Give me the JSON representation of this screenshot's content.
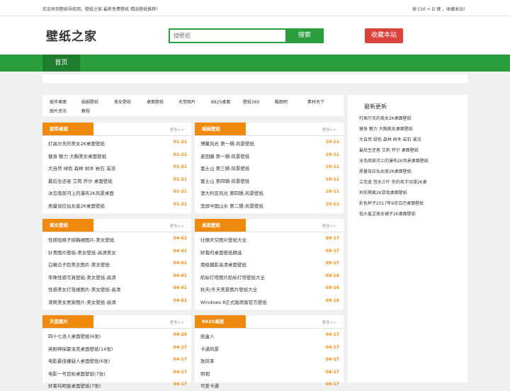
{
  "topbar": {
    "welcome": "欢迎来到壁纸导航网，壁纸之家-最新免费壁纸 精品壁纸推荐！",
    "shortcut": "按 Ctrl + D 键 ，收藏本站！"
  },
  "header": {
    "logo": "壁纸之家",
    "search_placeholder": "搜壁纸",
    "search_label": "搜索",
    "fav_label": "收藏本站"
  },
  "nav": {
    "home": "首页"
  },
  "tags": [
    "彼岸桌面",
    "娟娟壁纸",
    "美女壁纸",
    "桌面壁纸",
    "天堂图片",
    "8825桌面",
    "壁纸360",
    "酷图吧",
    "素材天下",
    "图片资讯",
    "教程"
  ],
  "more_label": "更多>>",
  "cards": [
    {
      "title": "彼岸桌面",
      "rows": [
        {
          "t": "打高尔夫的美女2K桌面壁纸",
          "d": "01-21"
        },
        {
          "t": "健身 魅力 大胸美女桌面壁纸",
          "d": "01-21"
        },
        {
          "t": "大自然 绿色 森林 树木 岩石 溪流",
          "d": "01-21"
        },
        {
          "t": "最后生还者 艾莉 乔尔 桌面壁纸",
          "d": "01-21"
        },
        {
          "t": "冰岛南部河上的瀑布2K风景桌面",
          "d": "01-21"
        },
        {
          "t": "质量效应仙女座2K桌面壁纸",
          "d": "01-21"
        }
      ]
    },
    {
      "title": "娟娟壁纸",
      "rows": [
        {
          "t": "博鳌风光 第一辑-风景壁纸",
          "d": "10-11"
        },
        {
          "t": "麦田圈 第一辑-风景壁纸",
          "d": "10-11"
        },
        {
          "t": "富士山 第三辑-风景壁纸",
          "d": "10-11"
        },
        {
          "t": "富士山 第四辑-风景壁纸",
          "d": "10-11"
        },
        {
          "t": "澳大利亚风光 第四辑-风景壁纸",
          "d": "10-11"
        },
        {
          "t": "宽屏中国山水 第二辑-风景壁纸",
          "d": "10-11"
        }
      ]
    },
    {
      "title": "美女壁纸",
      "rows": [
        {
          "t": "性感短格子抹胸裙图片-美女壁纸",
          "d": "04-01"
        },
        {
          "t": "针青图片壁纸-美女壁纸-高清美女",
          "d": "04-01"
        },
        {
          "t": "白嫩瓜子脸美女图片-美女壁纸",
          "d": "04-01"
        },
        {
          "t": "朱珠性感写真壁纸-美女壁纸-高清",
          "d": "04-01"
        },
        {
          "t": "性感美女灯笼裙图片-美女壁纸-高清",
          "d": "04-01"
        },
        {
          "t": "清爽美女居家图片-美女壁纸-高清",
          "d": "04-01"
        }
      ]
    },
    {
      "title": "桌面壁纸",
      "rows": [
        {
          "t": "壮丽天空图片壁纸大全",
          "d": "09-17"
        },
        {
          "t": "好看的桌面壁纸精选",
          "d": "09-17"
        },
        {
          "t": "南极摄影高清桌面壁纸",
          "d": "09-17"
        },
        {
          "t": "航标灯塔图片航标灯塔壁纸大全",
          "d": "09-16"
        },
        {
          "t": "秋天/冬天美景图片壁纸大全",
          "d": "09-16"
        },
        {
          "t": "Windows 8正式版原版官方壁纸",
          "d": "09-16"
        }
      ]
    },
    {
      "title": "天堂图片",
      "rows": [
        {
          "t": "四十七浪人桌面壁纸(6张)",
          "d": "04-20"
        },
        {
          "t": "英剧神探夏洛克桌面壁纸(14张)",
          "d": "04-17"
        },
        {
          "t": "电影最佳嫌疑人桌面壁纸(6张)",
          "d": "04-17"
        },
        {
          "t": "电影一号目标桌面壁纸(7张)",
          "d": "04-17"
        },
        {
          "t": "好莱坞明星桌面壁纸(7张)",
          "d": "04-17"
        }
      ]
    },
    {
      "title": "8825桌面",
      "rows": [
        {
          "t": "纸盒人",
          "d": "04-17"
        },
        {
          "t": "卡通风景",
          "d": "04-17"
        },
        {
          "t": "放风筝",
          "d": "04-17"
        },
        {
          "t": "照相",
          "d": "04-17"
        },
        {
          "t": "可爱卡通",
          "d": "04-17"
        }
      ]
    }
  ],
  "sidebar": {
    "title": "最新更新",
    "items": [
      "打高尔夫的美女2K桌面壁纸",
      "健身 魅力 大胸美女桌面壁纸",
      "大自然 绿色 森林 树木 岩石 溪流",
      "最后生还者 艾莉 乔尔 桌面壁纸",
      "冰岛南部河上的瀑布2K风景桌面壁纸",
      "质量效应仙女座2K桌面壁纸",
      "立花遥 宫水三叶 你的名字动漫2K桌",
      "异形隔离2K游戏桌面壁纸",
      "彩色杯子2017年9月日历桌面壁纸",
      "低头羞涩美女裙子2K桌面壁纸"
    ]
  }
}
